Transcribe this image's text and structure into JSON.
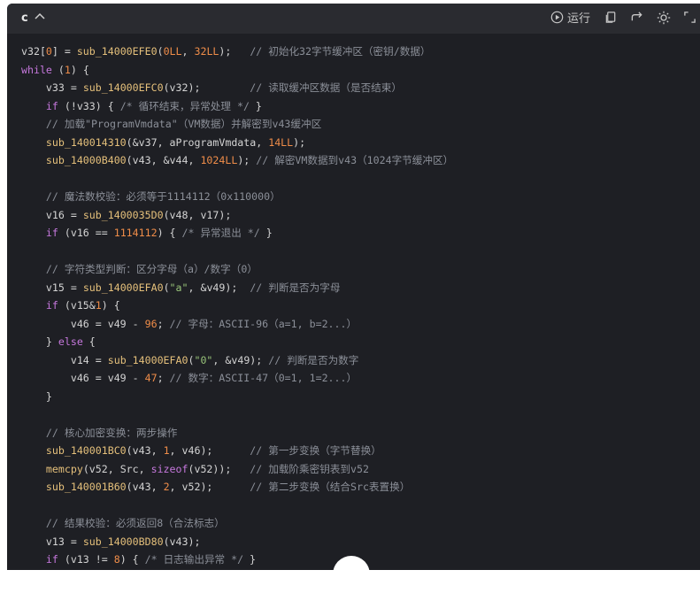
{
  "toolbar": {
    "language": "c",
    "run_label": "运行",
    "icons": [
      "chevron-up-icon",
      "play-circle-icon",
      "copy-icon",
      "redo-icon",
      "theme-sun-icon",
      "expand-icon"
    ]
  },
  "code": {
    "lines": [
      [
        {
          "t": "v32[",
          "c": ""
        },
        {
          "t": "0",
          "c": "n"
        },
        {
          "t": "] = ",
          "c": ""
        },
        {
          "t": "sub_14000EFE0",
          "c": "f"
        },
        {
          "t": "(",
          "c": ""
        },
        {
          "t": "0LL",
          "c": "n"
        },
        {
          "t": ", ",
          "c": ""
        },
        {
          "t": "32LL",
          "c": "n"
        },
        {
          "t": ");   ",
          "c": ""
        },
        {
          "t": "// 初始化32字节缓冲区（密钥/数据）",
          "c": "c"
        }
      ],
      [
        {
          "t": "while",
          "c": "k"
        },
        {
          "t": " (",
          "c": ""
        },
        {
          "t": "1",
          "c": "n"
        },
        {
          "t": ") {",
          "c": ""
        }
      ],
      [
        {
          "t": "    v33 = ",
          "c": ""
        },
        {
          "t": "sub_14000EFC0",
          "c": "f"
        },
        {
          "t": "(v32);        ",
          "c": ""
        },
        {
          "t": "// 读取缓冲区数据（是否结束）",
          "c": "c"
        }
      ],
      [
        {
          "t": "    ",
          "c": ""
        },
        {
          "t": "if",
          "c": "k"
        },
        {
          "t": " (!v33) { ",
          "c": ""
        },
        {
          "t": "/* 循环结束，异常处理 */",
          "c": "c"
        },
        {
          "t": " }",
          "c": ""
        }
      ],
      [
        {
          "t": "    ",
          "c": ""
        },
        {
          "t": "// 加载\"ProgramVmdata\"（VM数据）并解密到v43缓冲区",
          "c": "c"
        }
      ],
      [
        {
          "t": "    ",
          "c": ""
        },
        {
          "t": "sub_140014310",
          "c": "f"
        },
        {
          "t": "(&v37, aProgramVmdata, ",
          "c": ""
        },
        {
          "t": "14LL",
          "c": "n"
        },
        {
          "t": ");",
          "c": ""
        }
      ],
      [
        {
          "t": "    ",
          "c": ""
        },
        {
          "t": "sub_14000B400",
          "c": "f"
        },
        {
          "t": "(v43, &v44, ",
          "c": ""
        },
        {
          "t": "1024LL",
          "c": "n"
        },
        {
          "t": "); ",
          "c": ""
        },
        {
          "t": "// 解密VM数据到v43（1024字节缓冲区）",
          "c": "c"
        }
      ],
      [],
      [
        {
          "t": "    ",
          "c": ""
        },
        {
          "t": "// 魔法数校验：必须等于1114112（0x110000）",
          "c": "c"
        }
      ],
      [
        {
          "t": "    v16 = ",
          "c": ""
        },
        {
          "t": "sub_1400035D0",
          "c": "f"
        },
        {
          "t": "(v48, v17);",
          "c": ""
        }
      ],
      [
        {
          "t": "    ",
          "c": ""
        },
        {
          "t": "if",
          "c": "k"
        },
        {
          "t": " (v16 == ",
          "c": ""
        },
        {
          "t": "1114112",
          "c": "n"
        },
        {
          "t": ") { ",
          "c": ""
        },
        {
          "t": "/* 异常退出 */",
          "c": "c"
        },
        {
          "t": " }",
          "c": ""
        }
      ],
      [],
      [
        {
          "t": "    ",
          "c": ""
        },
        {
          "t": "// 字符类型判断：区分字母（a）/数字（0）",
          "c": "c"
        }
      ],
      [
        {
          "t": "    v15 = ",
          "c": ""
        },
        {
          "t": "sub_14000EFA0",
          "c": "f"
        },
        {
          "t": "(",
          "c": ""
        },
        {
          "t": "\"a\"",
          "c": "s"
        },
        {
          "t": ", &v49);  ",
          "c": ""
        },
        {
          "t": "// 判断是否为字母",
          "c": "c"
        }
      ],
      [
        {
          "t": "    ",
          "c": ""
        },
        {
          "t": "if",
          "c": "k"
        },
        {
          "t": " (v15&",
          "c": ""
        },
        {
          "t": "1",
          "c": "n"
        },
        {
          "t": ") {",
          "c": ""
        }
      ],
      [
        {
          "t": "        v46 = v49 - ",
          "c": ""
        },
        {
          "t": "96",
          "c": "n"
        },
        {
          "t": "; ",
          "c": ""
        },
        {
          "t": "// 字母：ASCII-96（a=1, b=2...）",
          "c": "c"
        }
      ],
      [
        {
          "t": "    } ",
          "c": ""
        },
        {
          "t": "else",
          "c": "k"
        },
        {
          "t": " {",
          "c": ""
        }
      ],
      [
        {
          "t": "        v14 = ",
          "c": ""
        },
        {
          "t": "sub_14000EFA0",
          "c": "f"
        },
        {
          "t": "(",
          "c": ""
        },
        {
          "t": "\"0\"",
          "c": "s"
        },
        {
          "t": ", &v49); ",
          "c": ""
        },
        {
          "t": "// 判断是否为数字",
          "c": "c"
        }
      ],
      [
        {
          "t": "        v46 = v49 - ",
          "c": ""
        },
        {
          "t": "47",
          "c": "n"
        },
        {
          "t": "; ",
          "c": ""
        },
        {
          "t": "// 数字：ASCII-47（0=1, 1=2...）",
          "c": "c"
        }
      ],
      [
        {
          "t": "    }",
          "c": ""
        }
      ],
      [],
      [
        {
          "t": "    ",
          "c": ""
        },
        {
          "t": "// 核心加密变换：两步操作",
          "c": "c"
        }
      ],
      [
        {
          "t": "    ",
          "c": ""
        },
        {
          "t": "sub_140001BC0",
          "c": "f"
        },
        {
          "t": "(v43, ",
          "c": ""
        },
        {
          "t": "1",
          "c": "n"
        },
        {
          "t": ", v46);      ",
          "c": ""
        },
        {
          "t": "// 第一步变换（字节替换）",
          "c": "c"
        }
      ],
      [
        {
          "t": "    ",
          "c": ""
        },
        {
          "t": "memcpy",
          "c": "f"
        },
        {
          "t": "(v52, Src, ",
          "c": ""
        },
        {
          "t": "sizeof",
          "c": "k"
        },
        {
          "t": "(v52));   ",
          "c": ""
        },
        {
          "t": "// 加载阶乘密钥表到v52",
          "c": "c"
        }
      ],
      [
        {
          "t": "    ",
          "c": ""
        },
        {
          "t": "sub_140001B60",
          "c": "f"
        },
        {
          "t": "(v43, ",
          "c": ""
        },
        {
          "t": "2",
          "c": "n"
        },
        {
          "t": ", v52);      ",
          "c": ""
        },
        {
          "t": "// 第二步变换（结合Src表置换）",
          "c": "c"
        }
      ],
      [],
      [
        {
          "t": "    ",
          "c": ""
        },
        {
          "t": "// 结果校验：必须返回8（合法标志）",
          "c": "c"
        }
      ],
      [
        {
          "t": "    v13 = ",
          "c": ""
        },
        {
          "t": "sub_14000BD80",
          "c": "f"
        },
        {
          "t": "(v43);",
          "c": ""
        }
      ],
      [
        {
          "t": "    ",
          "c": ""
        },
        {
          "t": "if",
          "c": "k"
        },
        {
          "t": " (v13 != ",
          "c": ""
        },
        {
          "t": "8",
          "c": "n"
        },
        {
          "t": ") { ",
          "c": ""
        },
        {
          "t": "/* 日志输出异常 */",
          "c": "c"
        },
        {
          "t": " }",
          "c": ""
        }
      ]
    ]
  }
}
